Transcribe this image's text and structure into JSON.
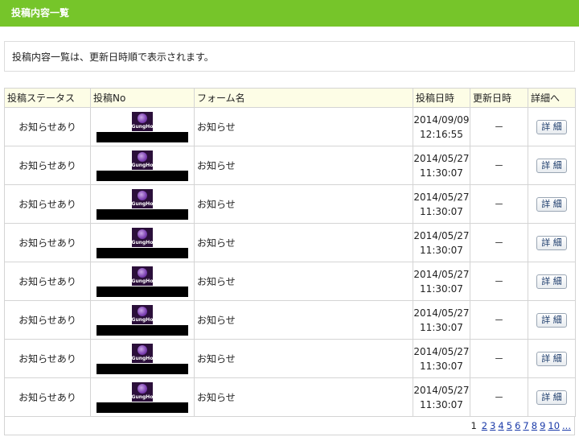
{
  "header": {
    "title": "投稿内容一覧"
  },
  "notice": {
    "text": "投稿内容一覧は、更新日時順で表示されます。"
  },
  "table": {
    "columns": [
      "投稿ステータス",
      "投稿No",
      "フォーム名",
      "投稿日時",
      "更新日時",
      "詳細へ"
    ],
    "rows": [
      {
        "status": "お知らせあり",
        "logo_text": "GungHo",
        "form": "お知らせ",
        "date": "2014/09/09",
        "time": "12:16:55",
        "updated": "－",
        "detail": "詳 細"
      },
      {
        "status": "お知らせあり",
        "logo_text": "GungHo",
        "form": "お知らせ",
        "date": "2014/05/27",
        "time": "11:30:07",
        "updated": "－",
        "detail": "詳 細"
      },
      {
        "status": "お知らせあり",
        "logo_text": "GungHo",
        "form": "お知らせ",
        "date": "2014/05/27",
        "time": "11:30:07",
        "updated": "－",
        "detail": "詳 細"
      },
      {
        "status": "お知らせあり",
        "logo_text": "GungHo",
        "form": "お知らせ",
        "date": "2014/05/27",
        "time": "11:30:07",
        "updated": "－",
        "detail": "詳 細"
      },
      {
        "status": "お知らせあり",
        "logo_text": "GungHo",
        "form": "お知らせ",
        "date": "2014/05/27",
        "time": "11:30:07",
        "updated": "－",
        "detail": "詳 細"
      },
      {
        "status": "お知らせあり",
        "logo_text": "GungHo",
        "form": "お知らせ",
        "date": "2014/05/27",
        "time": "11:30:07",
        "updated": "－",
        "detail": "詳 細"
      },
      {
        "status": "お知らせあり",
        "logo_text": "GungHo",
        "form": "お知らせ",
        "date": "2014/05/27",
        "time": "11:30:07",
        "updated": "－",
        "detail": "詳 細"
      },
      {
        "status": "お知らせあり",
        "logo_text": "GungHo",
        "form": "お知らせ",
        "date": "2014/05/27",
        "time": "11:30:07",
        "updated": "－",
        "detail": "詳 細"
      }
    ]
  },
  "pagination": {
    "current": "1",
    "pages": [
      "2",
      "3",
      "4",
      "5",
      "6",
      "7",
      "8",
      "9",
      "10",
      "..."
    ]
  },
  "colors": {
    "header_bg": "#76c52a",
    "table_header_bg": "#fdfde6",
    "link": "#1a3aa8"
  }
}
